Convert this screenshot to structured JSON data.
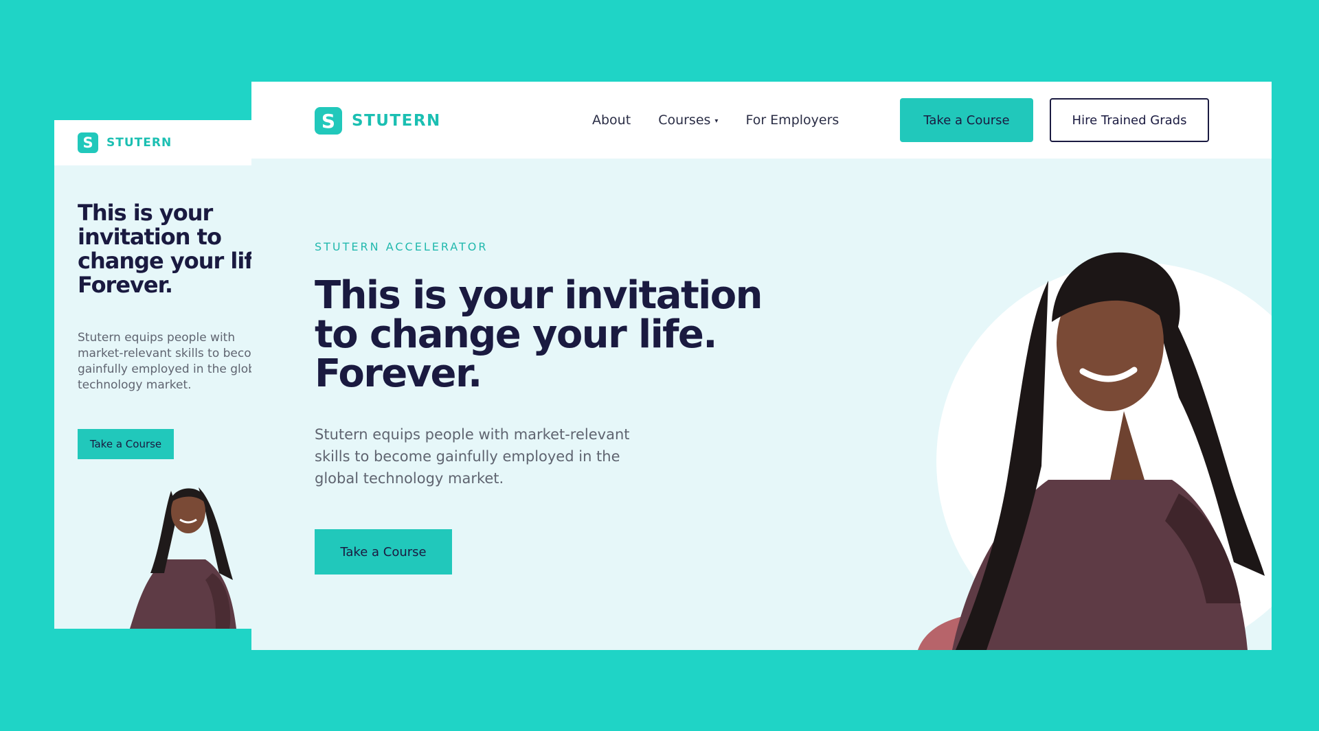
{
  "brand": {
    "name": "STUTERN",
    "mark": "S",
    "accent": "#21c8bb",
    "dark": "#1a1a40",
    "page_bg": "#1fd4c6",
    "hero_bg": "#e6f7f9"
  },
  "mobile": {
    "hero": {
      "title": "This is your\ninvitation to\nchange your life.\nForever.",
      "description": "Stutern equips people with\nmarket-relevant skills to become\ngainfully employed in the global\ntechnology market.",
      "cta_label": "Take a Course"
    }
  },
  "desktop": {
    "nav": {
      "items": [
        {
          "label": "About"
        },
        {
          "label": "Courses",
          "chevron": "chevron-down-icon"
        },
        {
          "label": "For Employers"
        }
      ],
      "primary_button": "Take a Course",
      "secondary_button": "Hire Trained Grads"
    },
    "hero": {
      "eyebrow": "STUTERN  ACCELERATOR",
      "title": "This is your invitation\nto change your life.\nForever.",
      "description": "Stutern equips people with market-relevant\nskills to become gainfully employed in the\nglobal technology market.",
      "cta_label": "Take a Course"
    }
  }
}
